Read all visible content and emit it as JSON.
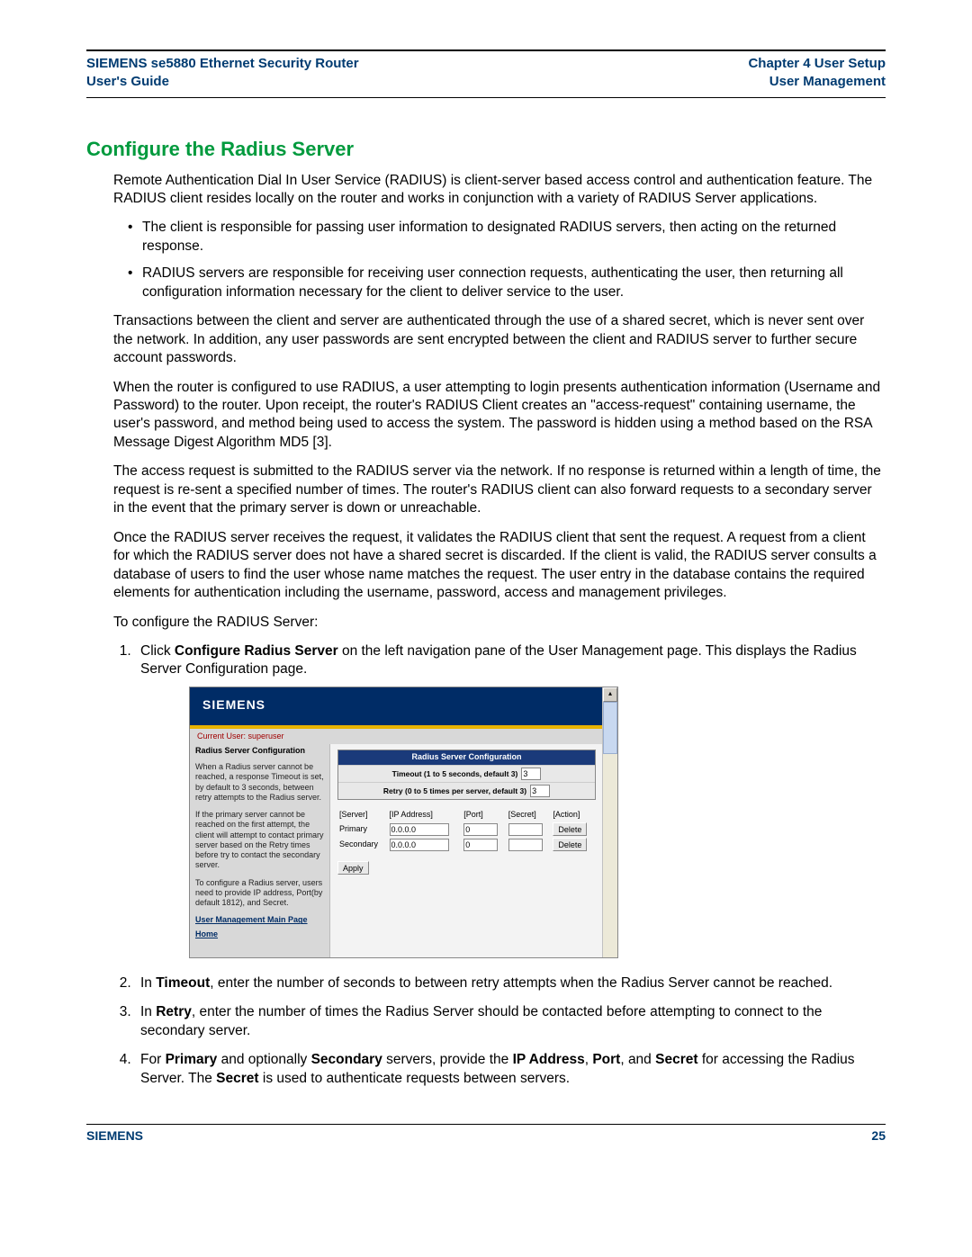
{
  "header": {
    "left1": "SIEMENS se5880 Ethernet Security Router",
    "left2": "User's Guide",
    "right1": "Chapter 4  User Setup",
    "right2": "User Management"
  },
  "title": "Configure the Radius Server",
  "intro": "Remote Authentication Dial In User Service (RADIUS) is client-server based access control and authentication feature. The RADIUS client resides locally on the router and works in conjunction with a variety of RADIUS Server applications.",
  "bullets": [
    "The client is responsible for passing user information to designated RADIUS servers, then acting on the returned response.",
    "RADIUS servers are responsible for receiving user connection requests, authenticating the user, then returning all configuration information necessary for the client to deliver service to the user."
  ],
  "paras": [
    "Transactions between the client and server are authenticated through the use of a shared secret, which is never sent over the network. In addition, any user passwords are sent encrypted between the client and RADIUS server to further secure account passwords.",
    "When the router is configured to use RADIUS, a user attempting to login presents authentication information (Username and Password) to the router. Upon receipt, the router's RADIUS Client creates an \"access-request\" containing username, the user's password, and method being used to access the system. The password is hidden using a method based on the RSA Message Digest Algorithm MD5 [3].",
    "The access request is submitted to the RADIUS server via the network. If no response is returned within a length of time, the request is re-sent a specified number of times. The router's RADIUS client can also forward requests to a secondary server in the event that the primary server is down or unreachable.",
    "Once the RADIUS server receives the request, it validates the RADIUS client that sent the request. A request from a client for which the RADIUS server does not have a shared secret is discarded. If the client is valid, the RADIUS server consults a database of users to find the user whose name matches the request. The user entry in the database contains the required elements for authentication including the username, password, access and management privileges.",
    "To configure the RADIUS Server:"
  ],
  "steps": {
    "s1a": "Click ",
    "s1b": "Configure Radius Server",
    "s1c": " on the left navigation pane of the User Management page. This displays the Radius Server Configuration page.",
    "s2a": "In ",
    "s2b": "Timeout",
    "s2c": ", enter the number of seconds to between retry attempts when the Radius Server cannot be reached.",
    "s3a": "In ",
    "s3b": "Retry",
    "s3c": ", enter the number of times the Radius Server should be contacted before attempting to connect to the secondary server.",
    "s4a": "For ",
    "s4b": "Primary",
    "s4c": " and optionally ",
    "s4d": "Secondary",
    "s4e": " servers, provide the ",
    "s4f": "IP Address",
    "s4g": ", ",
    "s4h": "Port",
    "s4i": ", and ",
    "s4j": "Secret",
    "s4k": " for accessing the Radius Server. The ",
    "s4l": "Secret",
    "s4m": " is used to authenticate requests between servers."
  },
  "screenshot": {
    "brand": "SIEMENS",
    "current_user": "Current User: superuser",
    "side_title": "Radius Server Configuration",
    "side_p1": "When a Radius server cannot be reached, a response Timeout is set, by default to 3 seconds, between retry attempts to the Radius server.",
    "side_p2": "If the primary server cannot be reached on the first attempt, the client will attempt to contact primary server based on the Retry times before try to contact the secondary server.",
    "side_p3": "To configure a Radius server, users need to provide IP address, Port(by default 1812), and Secret.",
    "link1": "User Management Main Page",
    "link2": "Home",
    "cfg_title": "Radius Server Configuration",
    "timeout_label": "Timeout (1 to 5 seconds, default 3)",
    "retry_label": "Retry (0 to 5 times per server, default 3)",
    "timeout_value": "3",
    "retry_value": "3",
    "cols": {
      "server": "[Server]",
      "ip": "[IP Address]",
      "port": "[Port]",
      "secret": "[Secret]",
      "action": "[Action]"
    },
    "rows": [
      {
        "name": "Primary",
        "ip": "0.0.0.0",
        "port": "0",
        "secret": "",
        "action": "Delete"
      },
      {
        "name": "Secondary",
        "ip": "0.0.0.0",
        "port": "0",
        "secret": "",
        "action": "Delete"
      }
    ],
    "apply": "Apply"
  },
  "footer": {
    "left": "SIEMENS",
    "right": "25"
  }
}
